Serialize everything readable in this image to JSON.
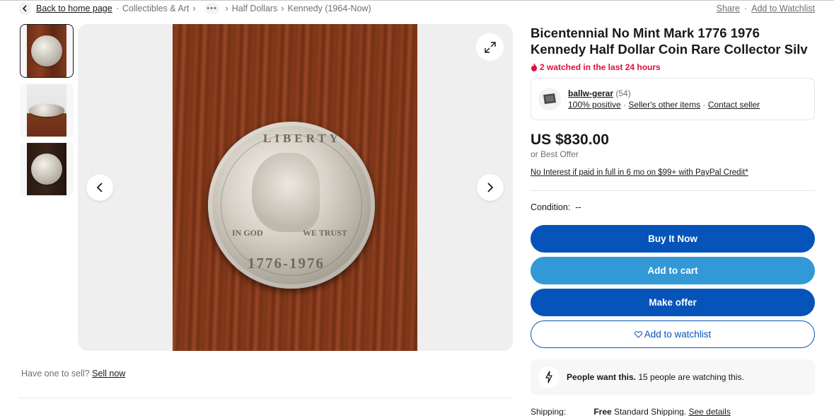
{
  "breadcrumb": {
    "back_label": "Back to home page",
    "items": [
      "Collectibles & Art",
      "Half Dollars",
      "Kennedy (1964-Now)"
    ],
    "more": "•••"
  },
  "top_links": {
    "share": "Share",
    "add_watchlist": "Add to Watchlist"
  },
  "gallery": {
    "coin_legend": "LIBERTY",
    "coin_motto_left": "IN GOD",
    "coin_motto_right": "WE TRUST",
    "coin_date": "1776-1976"
  },
  "sell": {
    "prompt": "Have one to sell?",
    "link": "Sell now"
  },
  "listing": {
    "title": "Bicentennial No Mint Mark 1776 1976 Kennedy Half Dollar Coin Rare Collector Silv",
    "watched": "2 watched in the last 24 hours",
    "price": "US $830.00",
    "best_offer": "or Best Offer",
    "financing": "No Interest if paid in full in 6 mo on $99+ with PayPal Credit*",
    "condition_label": "Condition:",
    "condition_value": "--"
  },
  "seller": {
    "name": "ballw-gerar",
    "feedback_count": "(54)",
    "positive": "100% positive",
    "other_items": "Seller's other items",
    "contact": "Contact seller"
  },
  "buttons": {
    "buy_now": "Buy It Now",
    "add_cart": "Add to cart",
    "make_offer": "Make offer",
    "add_watchlist": "Add to watchlist"
  },
  "demand": {
    "headline": "People want this.",
    "detail": "15 people are watching this."
  },
  "shipping": {
    "label": "Shipping:",
    "free": "Free",
    "method": "Standard Shipping.",
    "details": "See details"
  },
  "colors": {
    "primary": "#0654ba",
    "secondary": "#3398d6",
    "alert": "#e0103a"
  }
}
